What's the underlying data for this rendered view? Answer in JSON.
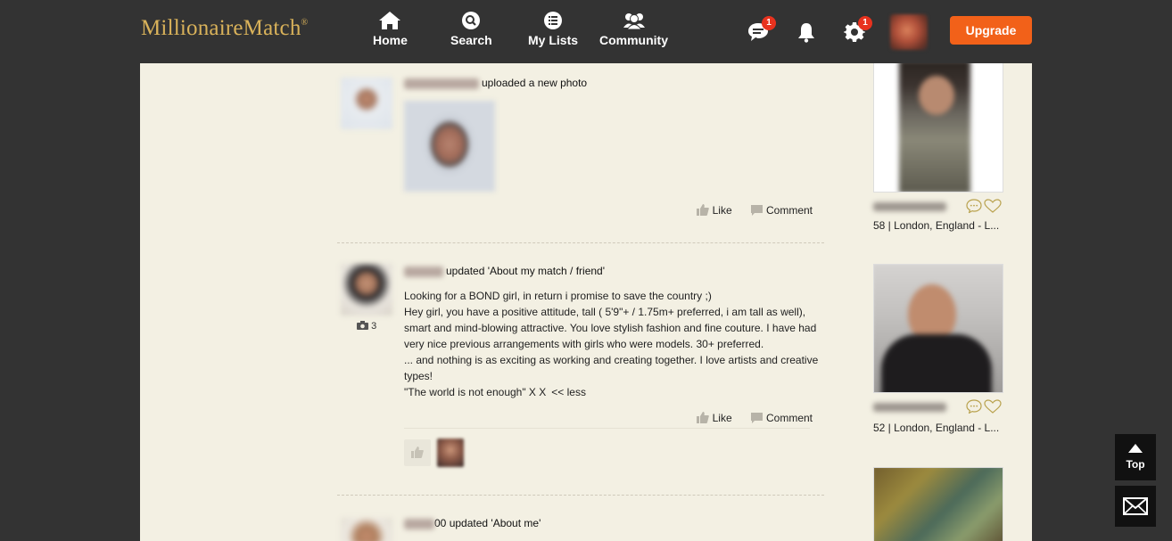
{
  "header": {
    "logo_text": "MillionaireMatch",
    "logo_mark": "®",
    "nav": [
      {
        "label": "Home",
        "icon": "home-icon"
      },
      {
        "label": "Search",
        "icon": "search-icon"
      },
      {
        "label": "My Lists",
        "icon": "list-icon"
      },
      {
        "label": "Community",
        "icon": "community-icon"
      }
    ],
    "messages_badge": "1",
    "settings_badge": "1",
    "upgrade_label": "Upgrade"
  },
  "feed": [
    {
      "action_text": "uploaded a new photo",
      "like_label": "Like",
      "comment_label": "Comment"
    },
    {
      "action_text": "updated 'About my match / friend'",
      "photo_count": "3",
      "lines": [
        "Looking for a BOND girl, in return i promise to save the country ;)",
        "Hey girl, you have a positive attitude, tall ( 5'9\"+ / 1.75m+ preferred, i am tall as well),",
        "smart and mind-blowing attractive. You love stylish fashion and fine couture. I have had",
        "very nice previous arrangements with girls who were models. 30+ preferred.",
        "... and nothing is as exciting as working and creating together. I love artists and creative",
        "types!",
        "\"The world is not enough\" X X"
      ],
      "less_label": "<< less",
      "like_label": "Like",
      "comment_label": "Comment"
    },
    {
      "name_suffix": "00",
      "action_text": "updated 'About me'"
    }
  ],
  "suggestions": [
    {
      "location": "58 | London, England - L..."
    },
    {
      "location": "52 | London, England - L..."
    }
  ],
  "floating": {
    "top_label": "Top"
  },
  "colors": {
    "header_bg": "#333333",
    "panel_bg": "#f3f0e3",
    "accent": "#f26119",
    "logo_gold": "#d9b25a",
    "badge_red": "#e8321e"
  }
}
